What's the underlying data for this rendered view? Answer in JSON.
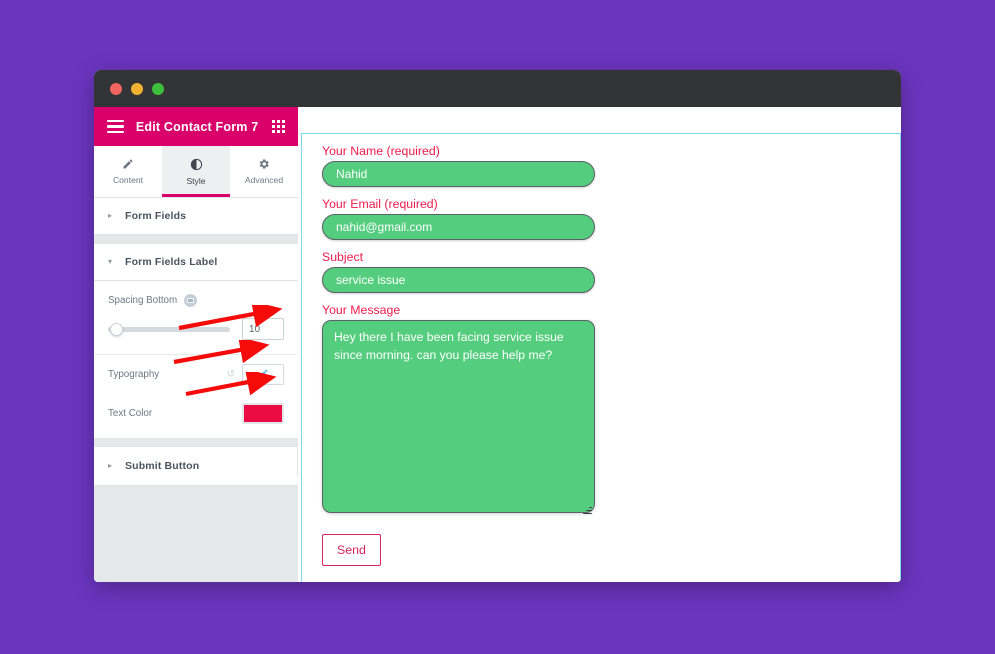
{
  "window": {
    "traffic_lights": [
      "close",
      "minimize",
      "maximize"
    ]
  },
  "panel": {
    "title": "Edit Contact Form 7",
    "menu_icon": "hamburger-icon",
    "grid_icon": "grid-icon",
    "tabs": [
      {
        "label": "Content",
        "icon": "pencil-icon",
        "active": false
      },
      {
        "label": "Style",
        "icon": "contrast-icon",
        "active": true
      },
      {
        "label": "Advanced",
        "icon": "gear-icon",
        "active": false
      }
    ],
    "sections": [
      {
        "label": "Form Fields",
        "expanded": false,
        "arrow": "▸"
      },
      {
        "label": "Form Fields Label",
        "expanded": true,
        "arrow": "▾"
      },
      {
        "label": "Submit Button",
        "expanded": false,
        "arrow": "▸"
      }
    ],
    "controls": {
      "spacing_bottom": {
        "label": "Spacing Bottom",
        "device_icon": "responsive-device-icon",
        "value": "10",
        "slider_percent": 2
      },
      "typography": {
        "label": "Typography",
        "reset_icon": "reset-icon",
        "edit_icon": "pencil-edit-icon"
      },
      "text_color": {
        "label": "Text Color",
        "swatch_hex": "#ED0B43"
      }
    },
    "collapse_handle_icon": "chevron-left-icon"
  },
  "form": {
    "fields": [
      {
        "name": "your-name",
        "label": "Your Name (required)",
        "value": "Nahid"
      },
      {
        "name": "your-email",
        "label": "Your Email (required)",
        "value": "nahid@gmail.com"
      },
      {
        "name": "your-subject",
        "label": "Subject",
        "value": "service issue"
      }
    ],
    "message": {
      "label": "Your Message",
      "value": "Hey there I have been facing service issue since morning. can you please help me?"
    },
    "submit_label": "Send"
  },
  "colors": {
    "page_background": "#6B35BE",
    "titlebar": "#333436",
    "panel_header": "#D9006C",
    "panel_background": "#E4E8EA",
    "label_red": "#ED1B4C",
    "input_green": "#55CD7E",
    "selection_cyan": "#7ED9EE",
    "annotation_red": "#F60B0B",
    "send_border": "#D9245C"
  },
  "annotations": [
    {
      "name": "arrow-to-spacing-value"
    },
    {
      "name": "arrow-to-typography-button"
    },
    {
      "name": "arrow-to-text-color-swatch"
    }
  ]
}
